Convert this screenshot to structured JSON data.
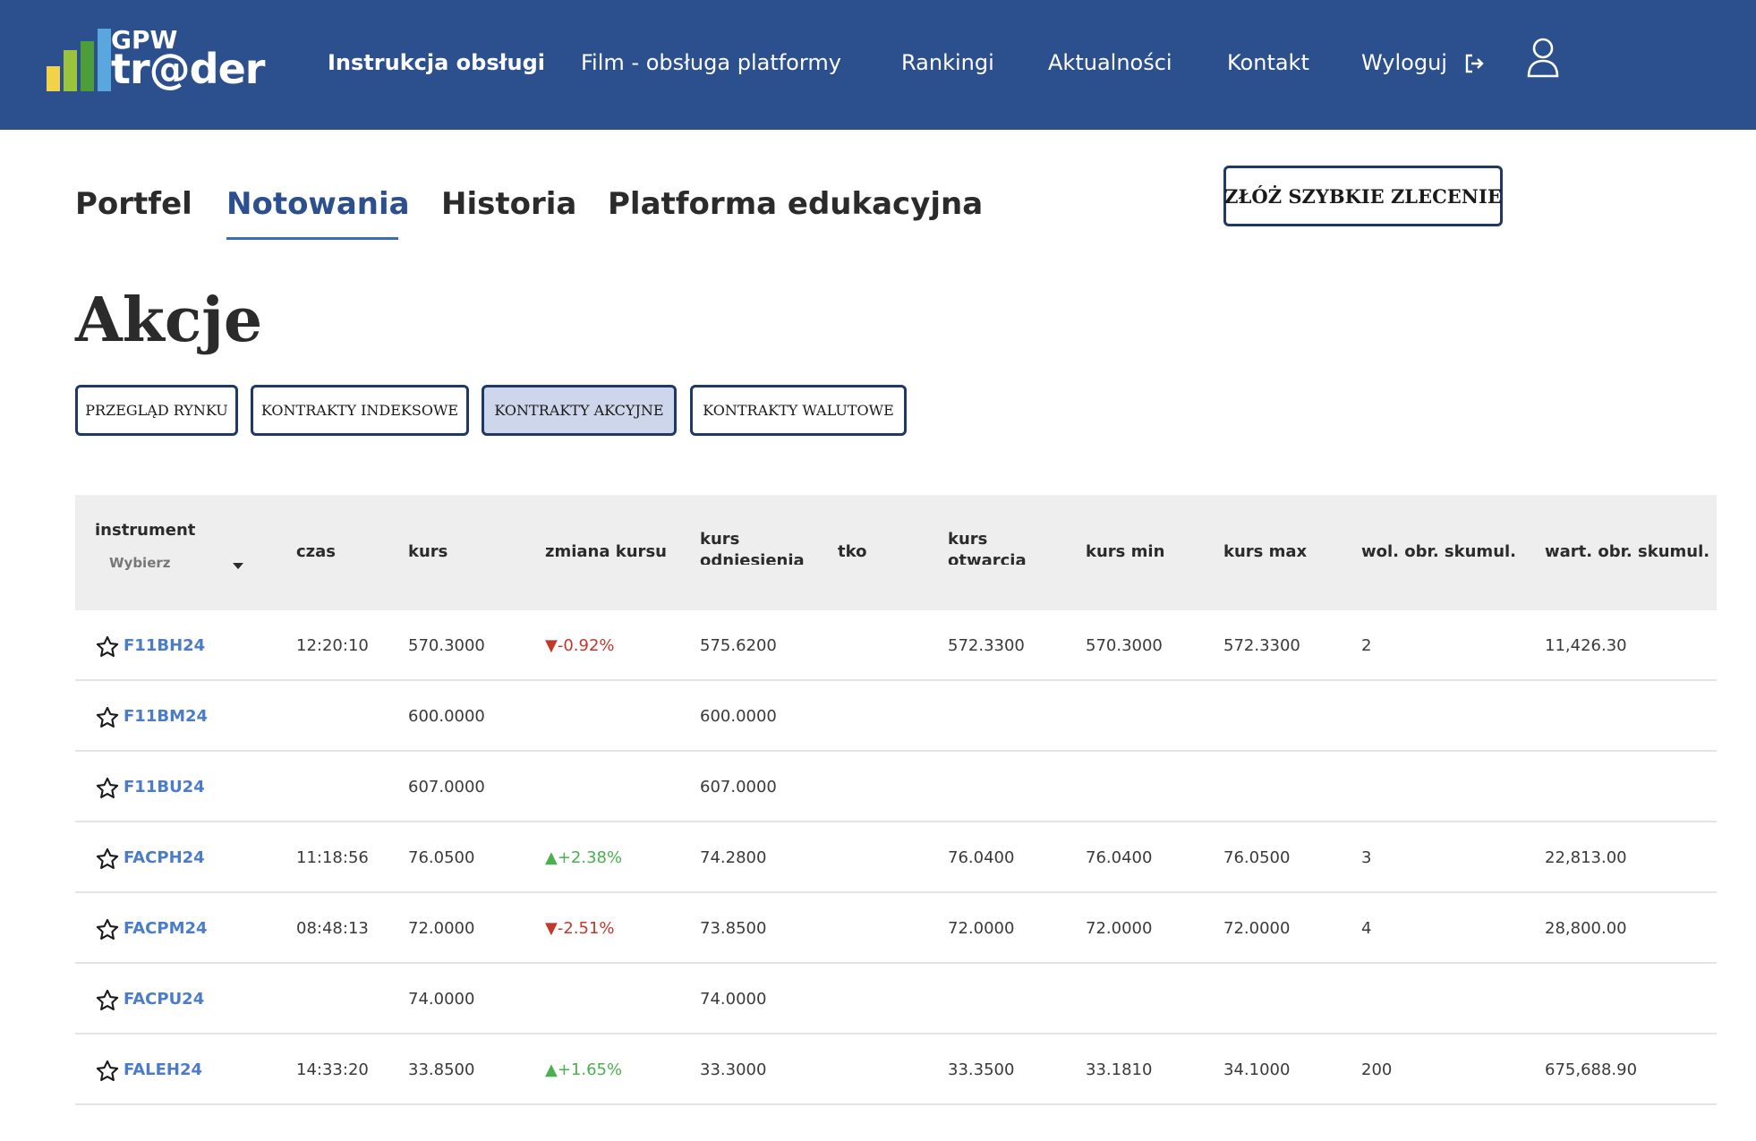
{
  "header": {
    "logo_top": "GPW",
    "logo_bottom": "tr@der",
    "nav": [
      {
        "label": "Instrukcja obsługi"
      },
      {
        "label": "Film - obsługa platformy"
      },
      {
        "label": "Rankingi"
      },
      {
        "label": "Aktualności"
      },
      {
        "label": "Kontakt"
      },
      {
        "label": "Wyloguj"
      }
    ]
  },
  "tabs": [
    {
      "label": "Portfel"
    },
    {
      "label": "Notowania"
    },
    {
      "label": "Historia"
    },
    {
      "label": "Platforma edukacyjna"
    }
  ],
  "quick_order_label": "ZŁÓŻ SZYBKIE ZLECENIE",
  "page_title": "Akcje",
  "filters": [
    {
      "label": "PRZEGLĄD RYNKU"
    },
    {
      "label": "KONTRAKTY INDEKSOWE"
    },
    {
      "label": "KONTRAKTY AKCYJNE"
    },
    {
      "label": "KONTRAKTY WALUTOWE"
    }
  ],
  "table": {
    "columns": [
      "instrument",
      "czas",
      "kurs",
      "zmiana kursu",
      "kurs odniesienia",
      "tko",
      "kurs otwarcia",
      "kurs min",
      "kurs max",
      "wol. obr. skumul.",
      "wart. obr. skumul."
    ],
    "instrument_select_placeholder": "Wybierz",
    "rows": [
      {
        "symbol": "F11BH24",
        "czas": "12:20:10",
        "kurs": "570.3000",
        "zmiana": "▼-0.92%",
        "dir": "down",
        "odniesienia": "575.6200",
        "tko": "",
        "otwarcia": "572.3300",
        "min": "570.3000",
        "max": "572.3300",
        "wol": "2",
        "wart": "11,426.30"
      },
      {
        "symbol": "F11BM24",
        "czas": "",
        "kurs": "600.0000",
        "zmiana": "",
        "dir": "",
        "odniesienia": "600.0000",
        "tko": "",
        "otwarcia": "",
        "min": "",
        "max": "",
        "wol": "",
        "wart": ""
      },
      {
        "symbol": "F11BU24",
        "czas": "",
        "kurs": "607.0000",
        "zmiana": "",
        "dir": "",
        "odniesienia": "607.0000",
        "tko": "",
        "otwarcia": "",
        "min": "",
        "max": "",
        "wol": "",
        "wart": ""
      },
      {
        "symbol": "FACPH24",
        "czas": "11:18:56",
        "kurs": "76.0500",
        "zmiana": "▲+2.38%",
        "dir": "up",
        "odniesienia": "74.2800",
        "tko": "",
        "otwarcia": "76.0400",
        "min": "76.0400",
        "max": "76.0500",
        "wol": "3",
        "wart": "22,813.00"
      },
      {
        "symbol": "FACPM24",
        "czas": "08:48:13",
        "kurs": "72.0000",
        "zmiana": "▼-2.51%",
        "dir": "down",
        "odniesienia": "73.8500",
        "tko": "",
        "otwarcia": "72.0000",
        "min": "72.0000",
        "max": "72.0000",
        "wol": "4",
        "wart": "28,800.00"
      },
      {
        "symbol": "FACPU24",
        "czas": "",
        "kurs": "74.0000",
        "zmiana": "",
        "dir": "",
        "odniesienia": "74.0000",
        "tko": "",
        "otwarcia": "",
        "min": "",
        "max": "",
        "wol": "",
        "wart": ""
      },
      {
        "symbol": "FALEH24",
        "czas": "14:33:20",
        "kurs": "33.8500",
        "zmiana": "▲+1.65%",
        "dir": "up",
        "odniesienia": "33.3000",
        "tko": "",
        "otwarcia": "33.3500",
        "min": "33.1810",
        "max": "34.1000",
        "wol": "200",
        "wart": "675,688.90"
      }
    ]
  },
  "colors": {
    "header_bg": "#2c4f8e",
    "link": "#4a7cc9",
    "down": "#c0392b",
    "up": "#4caf50",
    "active_filter_bg": "#cdd6ea"
  }
}
